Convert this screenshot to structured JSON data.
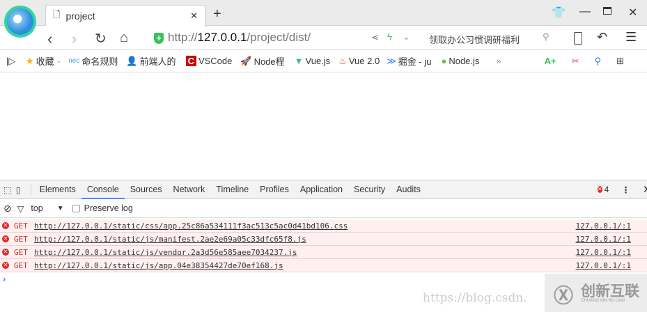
{
  "tab": {
    "title": "project"
  },
  "address": {
    "scheme": "http://",
    "host": "127.0.0.1",
    "path": "/project/dist/",
    "search_hint": "领取办公习惯调研福利"
  },
  "bookmarks": [
    "收藏",
    "命名规则",
    "前端人的",
    "VSCode",
    "Node程",
    "Vue.js",
    "Vue 2.0",
    "掘金 - ju",
    "Node.js"
  ],
  "bookmark_prefix_nec": "nec",
  "devtools": {
    "tabs": [
      "Elements",
      "Console",
      "Sources",
      "Network",
      "Timeline",
      "Profiles",
      "Application",
      "Security",
      "Audits"
    ],
    "active_tab": "Console",
    "error_count": "4",
    "context": "top",
    "preserve_log": "Preserve log",
    "messages": [
      {
        "method": "GET",
        "url": "http://127.0.0.1/static/css/app.25c86a534111f3ac513c5ac0d41bd106.css",
        "source": "127.0.0.1/:1"
      },
      {
        "method": "GET",
        "url": "http://127.0.0.1/static/js/manifest.2ae2e69a05c33dfc65f8.js",
        "source": "127.0.0.1/:1"
      },
      {
        "method": "GET",
        "url": "http://127.0.0.1/static/js/vendor.2a3d56e585aee7034237.js",
        "source": "127.0.0.1/:1"
      },
      {
        "method": "GET",
        "url": "http://127.0.0.1/static/js/app.04e38354427de70ef168.js",
        "source": "127.0.0.1/:1"
      }
    ]
  },
  "watermark": {
    "text": "https://blog.csdn.",
    "logo_cn": "创新互联",
    "logo_en": "CHUANG XIN HU LIAN"
  },
  "colors": {
    "error": "#e02828",
    "error_bg": "#fff0f0",
    "accent": "#4a8af4"
  }
}
